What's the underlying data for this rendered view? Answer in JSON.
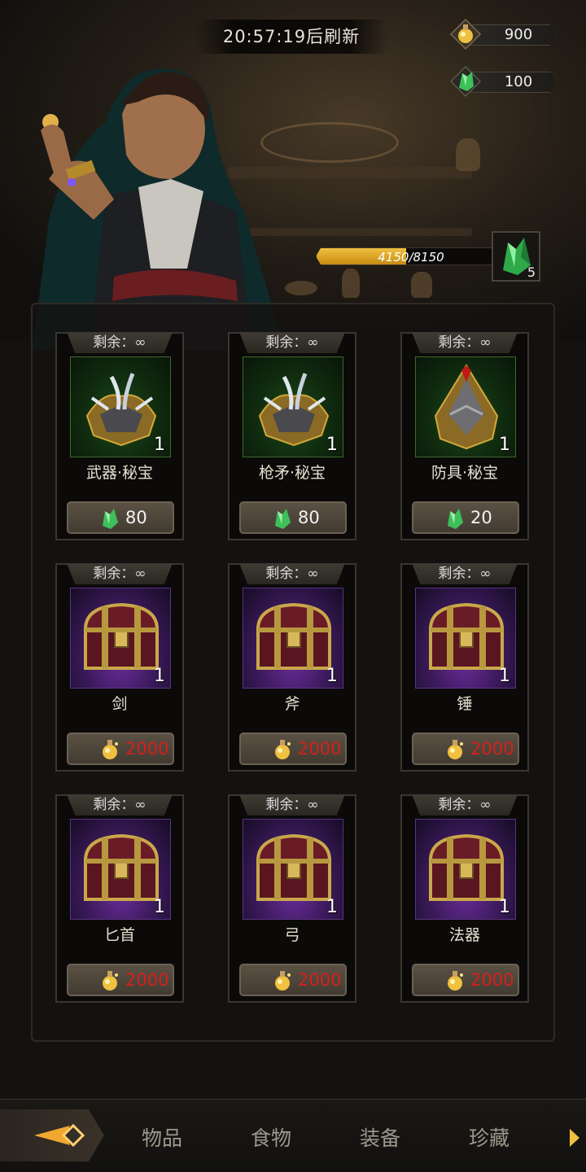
{
  "header": {
    "refresh_timer": "20:57:19后刷新"
  },
  "currencies": [
    {
      "name": "gold-potion",
      "value": "900"
    },
    {
      "name": "green-crystal",
      "value": "100"
    }
  ],
  "progress": {
    "current": "4150",
    "separator": "/",
    "max": "8150",
    "fraction": 0.509,
    "reward_count": "5"
  },
  "items": [
    {
      "remain": "剩余：∞",
      "name": "武器·秘宝",
      "qty": "1",
      "price": "80",
      "currency": "crystal",
      "type": "relic-weapon"
    },
    {
      "remain": "剩余：∞",
      "name": "枪矛·秘宝",
      "qty": "1",
      "price": "80",
      "currency": "crystal",
      "type": "relic-weapon"
    },
    {
      "remain": "剩余：∞",
      "name": "防具·秘宝",
      "qty": "1",
      "price": "20",
      "currency": "crystal",
      "type": "relic-armor"
    },
    {
      "remain": "剩余：∞",
      "name": "剑",
      "qty": "1",
      "price": "2000",
      "currency": "gold",
      "type": "chest"
    },
    {
      "remain": "剩余：∞",
      "name": "斧",
      "qty": "1",
      "price": "2000",
      "currency": "gold",
      "type": "chest"
    },
    {
      "remain": "剩余：∞",
      "name": "锤",
      "qty": "1",
      "price": "2000",
      "currency": "gold",
      "type": "chest"
    },
    {
      "remain": "剩余：∞",
      "name": "匕首",
      "qty": "1",
      "price": "2000",
      "currency": "gold",
      "type": "chest"
    },
    {
      "remain": "剩余：∞",
      "name": "弓",
      "qty": "1",
      "price": "2000",
      "currency": "gold",
      "type": "chest"
    },
    {
      "remain": "剩余：∞",
      "name": "法器",
      "qty": "1",
      "price": "2000",
      "currency": "gold",
      "type": "chest"
    }
  ],
  "nav": {
    "tabs": [
      "物品",
      "食物",
      "装备",
      "珍藏"
    ]
  },
  "colors": {
    "gold": "#f0c040",
    "crystal": "#3fbf5a",
    "price_red": "#d81e1e",
    "chest_purple": "#6a2d9b",
    "relic_green": "#1c4a1a"
  }
}
